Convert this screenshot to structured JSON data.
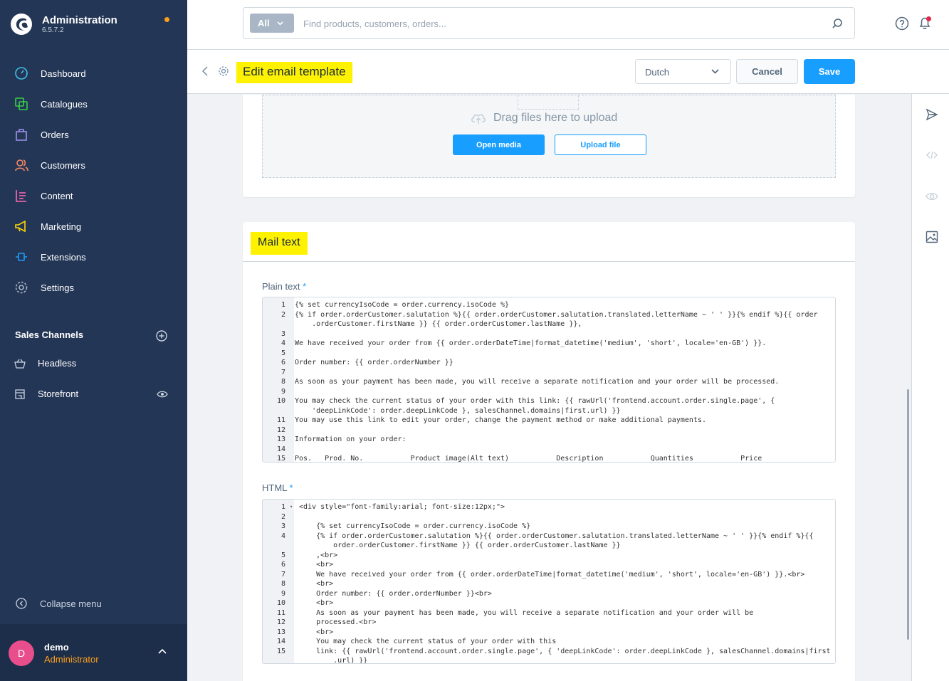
{
  "sidebar": {
    "app_title": "Administration",
    "version": "6.5.7.2",
    "nav": [
      {
        "label": "Dashboard",
        "icon": "dashboard-icon"
      },
      {
        "label": "Catalogues",
        "icon": "catalogues-icon"
      },
      {
        "label": "Orders",
        "icon": "orders-icon"
      },
      {
        "label": "Customers",
        "icon": "customers-icon"
      },
      {
        "label": "Content",
        "icon": "content-icon"
      },
      {
        "label": "Marketing",
        "icon": "marketing-icon"
      },
      {
        "label": "Extensions",
        "icon": "extensions-icon"
      },
      {
        "label": "Settings",
        "icon": "settings-icon"
      }
    ],
    "sales_channels_header": "Sales Channels",
    "sales_channels": [
      {
        "label": "Headless",
        "icon": "basket-icon"
      },
      {
        "label": "Storefront",
        "icon": "storefront-icon"
      }
    ],
    "collapse_label": "Collapse menu",
    "user": {
      "initial": "D",
      "name": "demo",
      "role": "Administrator"
    }
  },
  "topbar": {
    "search_type": "All",
    "search_placeholder": "Find products, customers, orders..."
  },
  "smartbar": {
    "title": "Edit email template",
    "language": "Dutch",
    "cancel_label": "Cancel",
    "save_label": "Save"
  },
  "media": {
    "drop_text": "Drag files here to upload",
    "open_media_label": "Open media",
    "upload_file_label": "Upload file"
  },
  "mail_text": {
    "title": "Mail text",
    "plain_label": "Plain text",
    "html_label": "HTML",
    "required_mark": "*"
  },
  "plain_code": [
    {
      "n": "1",
      "text": "{% set currencyIsoCode = order.currency.isoCode %}"
    },
    {
      "n": "2",
      "text": "{% if order.orderCustomer.salutation %}{{ order.orderCustomer.salutation.translated.letterName ~ ' ' }}{% endif %}{{ order"
    },
    {
      "n": "",
      "text": "    .orderCustomer.firstName }} {{ order.orderCustomer.lastName }},"
    },
    {
      "n": "3",
      "text": ""
    },
    {
      "n": "4",
      "text": "We have received your order from {{ order.orderDateTime|format_datetime('medium', 'short', locale='en-GB') }}."
    },
    {
      "n": "5",
      "text": ""
    },
    {
      "n": "6",
      "text": "Order number: {{ order.orderNumber }}"
    },
    {
      "n": "7",
      "text": ""
    },
    {
      "n": "8",
      "text": "As soon as your payment has been made, you will receive a separate notification and your order will be processed."
    },
    {
      "n": "9",
      "text": ""
    },
    {
      "n": "10",
      "text": "You may check the current status of your order with this link: {{ rawUrl('frontend.account.order.single.page', {"
    },
    {
      "n": "",
      "text": "    'deepLinkCode': order.deepLinkCode }, salesChannel.domains|first.url) }}"
    },
    {
      "n": "11",
      "text": "You may use this link to edit your order, change the payment method or make additional payments."
    },
    {
      "n": "12",
      "text": ""
    },
    {
      "n": "13",
      "text": "Information on your order:"
    },
    {
      "n": "14",
      "text": ""
    },
    {
      "n": "15",
      "text": "Pos.   Prod. No.           Product image(Alt text)           Description           Quantities           Price"
    }
  ],
  "html_code": [
    {
      "n": "1",
      "text": "<div style=\"font-family:arial; font-size:12px;\">"
    },
    {
      "n": "2",
      "text": ""
    },
    {
      "n": "3",
      "text": "    {% set currencyIsoCode = order.currency.isoCode %}"
    },
    {
      "n": "4",
      "text": "    {% if order.orderCustomer.salutation %}{{ order.orderCustomer.salutation.translated.letterName ~ ' ' }}{% endif %}{{"
    },
    {
      "n": "",
      "text": "        order.orderCustomer.firstName }} {{ order.orderCustomer.lastName }}"
    },
    {
      "n": "5",
      "text": "    ,<br>"
    },
    {
      "n": "6",
      "text": "    <br>"
    },
    {
      "n": "7",
      "text": "    We have received your order from {{ order.orderDateTime|format_datetime('medium', 'short', locale='en-GB') }}.<br>"
    },
    {
      "n": "8",
      "text": "    <br>"
    },
    {
      "n": "9",
      "text": "    Order number: {{ order.orderNumber }}<br>"
    },
    {
      "n": "10",
      "text": "    <br>"
    },
    {
      "n": "11",
      "text": "    As soon as your payment has been made, you will receive a separate notification and your order will be"
    },
    {
      "n": "12",
      "text": "    processed.<br>"
    },
    {
      "n": "13",
      "text": "    <br>"
    },
    {
      "n": "14",
      "text": "    You may check the current status of your order with this"
    },
    {
      "n": "15",
      "text": "    link: {{ rawUrl('frontend.account.order.single.page', { 'deepLinkCode': order.deepLinkCode }, salesChannel.domains|first"
    },
    {
      "n": "",
      "text": "        .url) }}"
    }
  ],
  "colors": {
    "sidebar_bg": "#243656",
    "accent": "#189eff",
    "highlight": "#fff200",
    "orange": "#ff9f1a"
  }
}
